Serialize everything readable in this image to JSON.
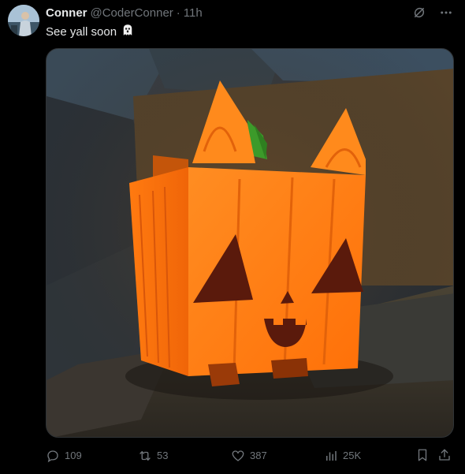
{
  "author": {
    "name": "Conner",
    "handle": "@CoderConner",
    "separator": "·",
    "time": "11h",
    "avatar_icon": "avatar-photo"
  },
  "tweet": {
    "text": "See yall soon",
    "emoji": "👻"
  },
  "top_actions": {
    "grok_icon": "grok-icon",
    "more_icon": "more-icon"
  },
  "media": {
    "description_icon": "pumpkin-cat-render"
  },
  "actions": {
    "reply_count": "109",
    "repost_count": "53",
    "like_count": "387",
    "view_count": "25K"
  },
  "colors": {
    "background": "#000000",
    "text": "#e7e9ea",
    "muted": "#71767b",
    "pumpkin": "#ff7f16",
    "pumpkin_dark": "#e2620a",
    "face": "#5a1a0c",
    "stem": "#3c9a2a"
  }
}
